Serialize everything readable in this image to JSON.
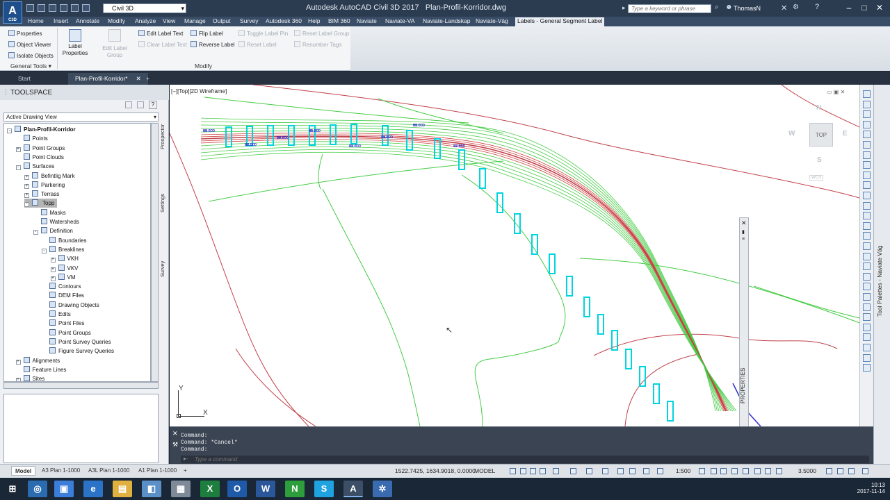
{
  "app": {
    "logo": "A",
    "logo_sub": "C3D",
    "title": "Autodesk AutoCAD Civil 3D 2017",
    "file": "Plan-Profil-Korridor.dwg",
    "workspace": "Civil 3D",
    "search_placeholder": "Type a keyword or phrase",
    "user": "ThomasN"
  },
  "menu": [
    "Home",
    "Insert",
    "Annotate",
    "Modify",
    "Analyze",
    "View",
    "Manage",
    "Output",
    "Survey",
    "Autodesk 360",
    "Help",
    "BIM 360",
    "Naviate",
    "Naviate-VA",
    "Naviate-Landskap",
    "Naviate-Väg",
    "Labels - General Segment Label"
  ],
  "ribbon": {
    "general_tools": {
      "title": "General Tools",
      "items": [
        "Properties",
        "Object Viewer",
        "Isolate Objects"
      ]
    },
    "modify": {
      "title": "Modify",
      "label_properties": "Label Properties",
      "edit_label_group": "Edit Label Group",
      "edit_label_text": "Edit Label Text",
      "clear_label_text": "Clear Label Text",
      "flip_label": "Flip Label",
      "reverse_label": "Reverse Label",
      "toggle_label_pin": "Toggle Label Pin",
      "reset_label": "Reset Label",
      "reset_label_group": "Reset Label Group",
      "renumber_tags": "Renumber Tags"
    }
  },
  "file_tabs": [
    "Start",
    "Plan-Profil-Korridor*"
  ],
  "toolspace": {
    "title": "TOOLSPACE",
    "view": "Active Drawing View",
    "side_tabs": [
      "Prospector",
      "Settings",
      "Survey"
    ],
    "tree": [
      {
        "label": "Plan-Profil-Korridor",
        "level": 0,
        "toggle": "-",
        "bold": true
      },
      {
        "label": "Points",
        "level": 1,
        "toggle": ""
      },
      {
        "label": "Point Groups",
        "level": 1,
        "toggle": "+"
      },
      {
        "label": "Point Clouds",
        "level": 1,
        "toggle": ""
      },
      {
        "label": "Surfaces",
        "level": 1,
        "toggle": "-"
      },
      {
        "label": "Befintlig Mark",
        "level": 2,
        "toggle": "+"
      },
      {
        "label": "Parkering",
        "level": 2,
        "toggle": "+"
      },
      {
        "label": "Terrass",
        "level": 2,
        "toggle": "+"
      },
      {
        "label": "Topp",
        "level": 2,
        "toggle": "-",
        "selected": true
      },
      {
        "label": "Masks",
        "level": 3,
        "toggle": ""
      },
      {
        "label": "Watersheds",
        "level": 3,
        "toggle": ""
      },
      {
        "label": "Definition",
        "level": 3,
        "toggle": "-"
      },
      {
        "label": "Boundaries",
        "level": 4,
        "toggle": ""
      },
      {
        "label": "Breaklines",
        "level": 4,
        "toggle": "-"
      },
      {
        "label": "VKH",
        "level": 5,
        "toggle": "+"
      },
      {
        "label": "VKV",
        "level": 5,
        "toggle": "+"
      },
      {
        "label": "VM",
        "level": 5,
        "toggle": "+"
      },
      {
        "label": "Contours",
        "level": 4,
        "toggle": ""
      },
      {
        "label": "DEM Files",
        "level": 4,
        "toggle": ""
      },
      {
        "label": "Drawing Objects",
        "level": 4,
        "toggle": ""
      },
      {
        "label": "Edits",
        "level": 4,
        "toggle": ""
      },
      {
        "label": "Point Files",
        "level": 4,
        "toggle": ""
      },
      {
        "label": "Point Groups",
        "level": 4,
        "toggle": ""
      },
      {
        "label": "Point Survey Queries",
        "level": 4,
        "toggle": ""
      },
      {
        "label": "Figure Survey Queries",
        "level": 4,
        "toggle": ""
      },
      {
        "label": "Alignments",
        "level": 1,
        "toggle": "+"
      },
      {
        "label": "Feature Lines",
        "level": 1,
        "toggle": ""
      },
      {
        "label": "Sites",
        "level": 1,
        "toggle": "+"
      }
    ]
  },
  "viewport": {
    "label": "[−][Top][2D Wireframe]",
    "viewcube": "TOP",
    "compass": {
      "n": "N",
      "s": "S",
      "e": "E",
      "w": "W"
    },
    "wcs": "WCS",
    "ucs_x": "X",
    "ucs_y": "Y",
    "elevation_labels": [
      "90.000",
      "88.500",
      "87.000",
      "85.500",
      "84.000",
      "82.500",
      "81.000",
      "79.500",
      "78.000"
    ]
  },
  "properties_panel": "PROPERTIES",
  "tool_palettes": "Tool Palettes - Naviate Väg",
  "command": {
    "history": [
      "Command:",
      "Command: *Cancel*",
      "Command:"
    ],
    "placeholder": "Type a command"
  },
  "layout_tabs": [
    "Model",
    "A3 Plan 1-1000",
    "A3L Plan 1-1000",
    "A1 Plan 1-1000"
  ],
  "status": {
    "coords": "1522.7425, 1634.9018, 0.0000",
    "space": "MODEL",
    "scale": "1:500",
    "units": "3.5000"
  },
  "clock": {
    "time": "10:13",
    "date": "2017-11-14"
  },
  "colors": {
    "road_magenta": "#e0308a",
    "surface_green": "#44cc44",
    "contour_red": "#c0404a",
    "station_cyan": "#00d4e0",
    "label_blue": "#2b2bd0"
  }
}
